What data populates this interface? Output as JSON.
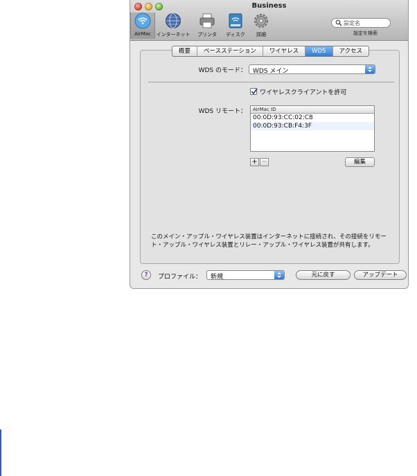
{
  "window": {
    "title": "Business"
  },
  "toolbar": {
    "items": [
      {
        "label": "AirMac",
        "icon": "airmac-icon"
      },
      {
        "label": "インターネット",
        "icon": "globe-icon"
      },
      {
        "label": "プリンタ",
        "icon": "printer-icon"
      },
      {
        "label": "ディスク",
        "icon": "disk-icon"
      },
      {
        "label": "詳細",
        "icon": "gear-icon"
      }
    ],
    "search_placeholder": "設定名",
    "search_caption": "設定を検索"
  },
  "tabs": [
    {
      "label": "概要",
      "active": false
    },
    {
      "label": "ベースステーション",
      "active": false
    },
    {
      "label": "ワイヤレス",
      "active": false
    },
    {
      "label": "WDS",
      "active": true
    },
    {
      "label": "アクセス",
      "active": false
    }
  ],
  "wds": {
    "mode_label": "WDS のモード：",
    "mode_value": "WDS メイン",
    "allow_clients_label": "ワイヤレスクライアントを許可",
    "allow_clients_checked": true,
    "remote_label": "WDS リモート：",
    "list_header": "AirMac ID",
    "remotes": [
      "00:0D:93:CC:02:C8",
      "00:0D:93:CB:F4:3F"
    ],
    "add_label": "+",
    "remove_label": "−",
    "edit_label": "編集"
  },
  "description": "このメイン・アップル・ワイヤレス装置はインターネットに接続され、その接続をリモート・アップル・ワイヤレス装置とリレー・アップル・ワイヤレス装置が共有します。",
  "footer": {
    "help_label": "?",
    "profile_label": "プロファイル：",
    "profile_value": "新規",
    "revert_label": "元に戻す",
    "update_label": "アップデート"
  },
  "colors": {
    "accent": "#2f7cd8",
    "window_bg": "#e8e8e8"
  }
}
